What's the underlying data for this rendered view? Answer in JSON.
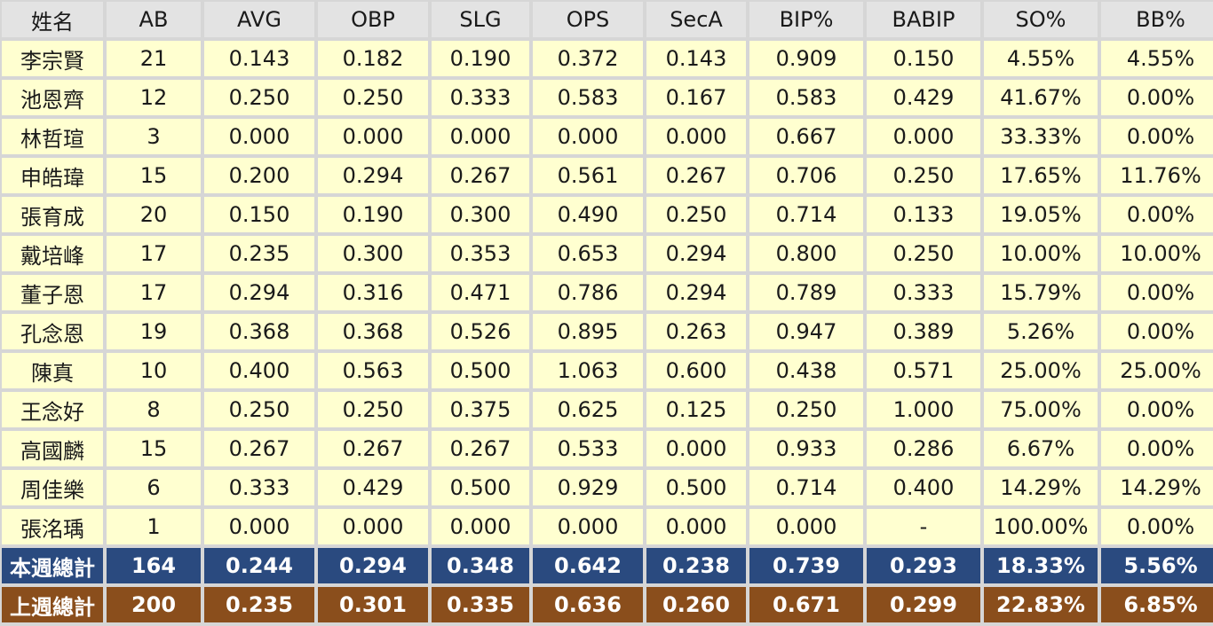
{
  "columns": [
    "姓名",
    "AB",
    "AVG",
    "OBP",
    "SLG",
    "OPS",
    "SecA",
    "BIP%",
    "BABIP",
    "SO%",
    "BB%"
  ],
  "rows": [
    [
      "李宗賢",
      "21",
      "0.143",
      "0.182",
      "0.190",
      "0.372",
      "0.143",
      "0.909",
      "0.150",
      "4.55%",
      "4.55%"
    ],
    [
      "池恩齊",
      "12",
      "0.250",
      "0.250",
      "0.333",
      "0.583",
      "0.167",
      "0.583",
      "0.429",
      "41.67%",
      "0.00%"
    ],
    [
      "林哲瑄",
      "3",
      "0.000",
      "0.000",
      "0.000",
      "0.000",
      "0.000",
      "0.667",
      "0.000",
      "33.33%",
      "0.00%"
    ],
    [
      "申皓瑋",
      "15",
      "0.200",
      "0.294",
      "0.267",
      "0.561",
      "0.267",
      "0.706",
      "0.250",
      "17.65%",
      "11.76%"
    ],
    [
      "張育成",
      "20",
      "0.150",
      "0.190",
      "0.300",
      "0.490",
      "0.250",
      "0.714",
      "0.133",
      "19.05%",
      "0.00%"
    ],
    [
      "戴培峰",
      "17",
      "0.235",
      "0.300",
      "0.353",
      "0.653",
      "0.294",
      "0.800",
      "0.250",
      "10.00%",
      "10.00%"
    ],
    [
      "董子恩",
      "17",
      "0.294",
      "0.316",
      "0.471",
      "0.786",
      "0.294",
      "0.789",
      "0.333",
      "15.79%",
      "0.00%"
    ],
    [
      "孔念恩",
      "19",
      "0.368",
      "0.368",
      "0.526",
      "0.895",
      "0.263",
      "0.947",
      "0.389",
      "5.26%",
      "0.00%"
    ],
    [
      "陳真",
      "10",
      "0.400",
      "0.563",
      "0.500",
      "1.063",
      "0.600",
      "0.438",
      "0.571",
      "25.00%",
      "25.00%"
    ],
    [
      "王念好",
      "8",
      "0.250",
      "0.250",
      "0.375",
      "0.625",
      "0.125",
      "0.250",
      "1.000",
      "75.00%",
      "0.00%"
    ],
    [
      "高國麟",
      "15",
      "0.267",
      "0.267",
      "0.267",
      "0.533",
      "0.000",
      "0.933",
      "0.286",
      "6.67%",
      "0.00%"
    ],
    [
      "周佳樂",
      "6",
      "0.333",
      "0.429",
      "0.500",
      "0.929",
      "0.500",
      "0.714",
      "0.400",
      "14.29%",
      "14.29%"
    ],
    [
      "張洺瑀",
      "1",
      "0.000",
      "0.000",
      "0.000",
      "0.000",
      "0.000",
      "0.000",
      "-",
      "100.00%",
      "0.00%"
    ]
  ],
  "total_this_week": [
    "本週總計",
    "164",
    "0.244",
    "0.294",
    "0.348",
    "0.642",
    "0.238",
    "0.739",
    "0.293",
    "18.33%",
    "5.56%"
  ],
  "total_last_week": [
    "上週總計",
    "200",
    "0.235",
    "0.301",
    "0.335",
    "0.636",
    "0.260",
    "0.671",
    "0.299",
    "22.83%",
    "6.85%"
  ],
  "colors": {
    "header_bg": "#e3e3e3",
    "cell_bg": "#ffffd0",
    "this_week_bg": "#2a4a7f",
    "last_week_bg": "#8a4e1c",
    "grid": "#d6d6d6"
  }
}
